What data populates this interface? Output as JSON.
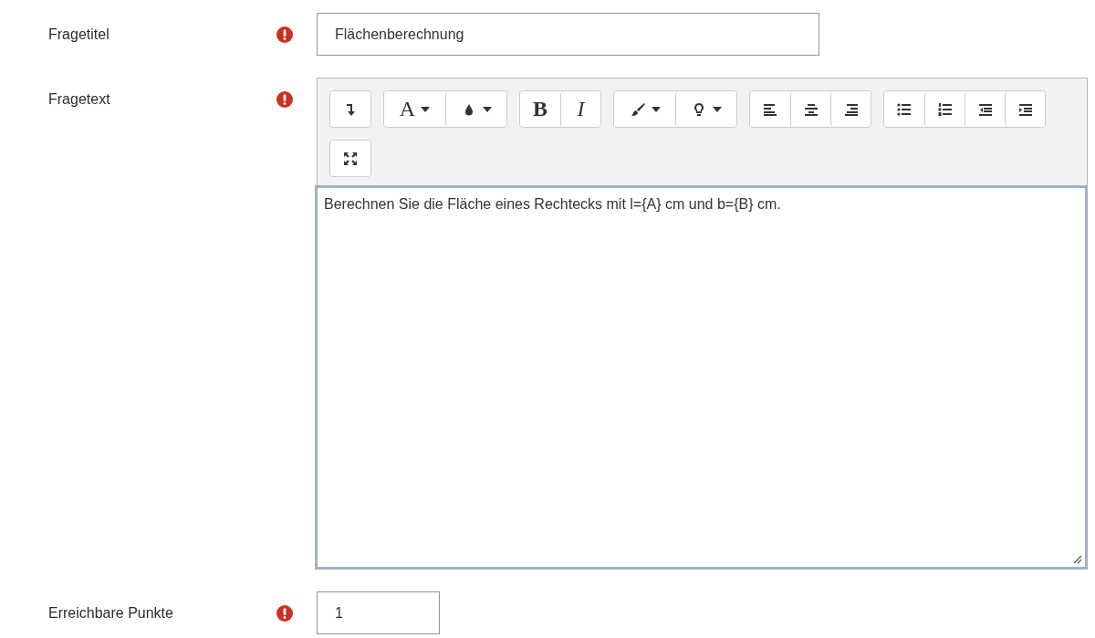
{
  "fields": [
    {
      "kind": "text",
      "label": "Fragetitel",
      "required": true,
      "value": "Flächenberechnung"
    },
    {
      "kind": "editor",
      "label": "Fragetext",
      "required": true,
      "toolbar": [
        [
          {
            "dropdown": false
          }
        ],
        [
          {
            "label": "A",
            "dropdown": true
          },
          {
            "dropdown": true
          }
        ],
        [
          {
            "label": "B",
            "dropdown": false
          },
          {
            "label": "I",
            "dropdown": false
          }
        ],
        [
          {
            "dropdown": true
          },
          {
            "dropdown": true
          }
        ],
        [
          {
            "dropdown": false
          },
          {
            "dropdown": false
          },
          {
            "dropdown": false
          }
        ],
        [
          {
            "dropdown": false
          },
          {
            "dropdown": false
          },
          {
            "dropdown": false
          },
          {
            "dropdown": false
          }
        ],
        [
          {
            "dropdown": false
          }
        ]
      ],
      "value": "Berechnen Sie die Fläche eines Rechtecks mit l={A} cm und b={B} cm."
    },
    {
      "kind": "number",
      "label": "Erreichbare Punkte",
      "required": true,
      "value": "1"
    }
  ]
}
